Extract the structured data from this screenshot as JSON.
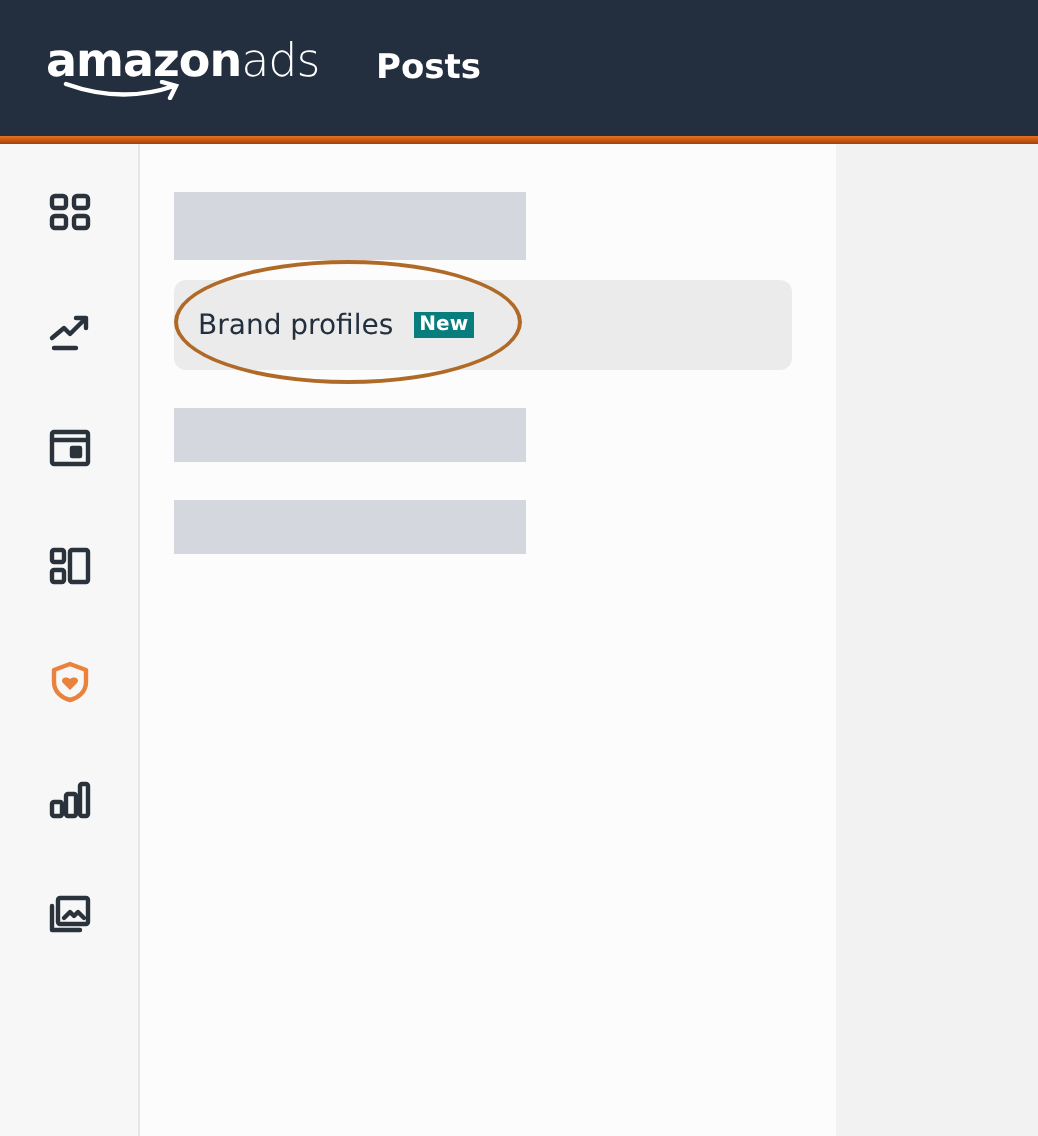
{
  "header": {
    "logo": "**amazon**ads",
    "title": "Posts"
  },
  "rail": {
    "items": [
      {
        "selected": false
      },
      {
        "selected": false
      },
      {
        "selected": false
      },
      {
        "selected": false
      },
      {
        "selected": true
      },
      {
        "selected": false
      },
      {
        "selected": false
      }
    ]
  },
  "menu": {
    "items": [
      {
        "kind": "skeleton"
      },
      {
        "kind": "link",
        "label": "Brand profiles",
        "badge": "New",
        "selected": true,
        "circled": true
      },
      {
        "kind": "skeleton"
      },
      {
        "kind": "skeleton"
      }
    ]
  }
}
